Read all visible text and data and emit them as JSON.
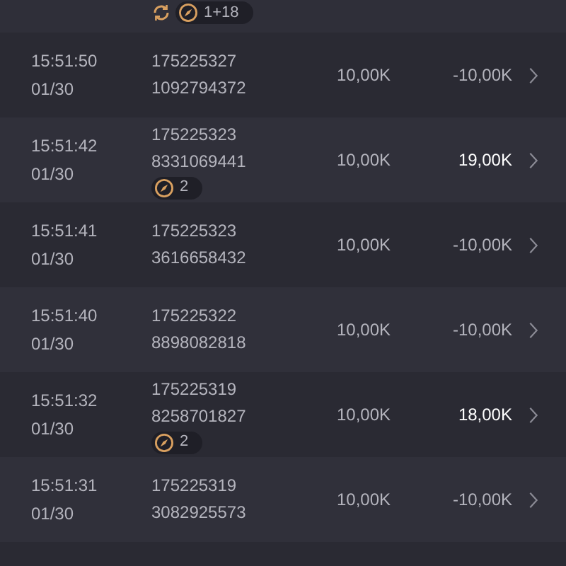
{
  "top_row": {
    "badges": [
      {
        "kind": "sync"
      },
      {
        "kind": "compass",
        "count": "1+18"
      }
    ]
  },
  "rows": [
    {
      "time": "15:51:50",
      "date": "01/30",
      "round": "175225327",
      "ticket": "1092794372",
      "badges": [],
      "bet": "10,00K",
      "result": "-10,00K",
      "won": false
    },
    {
      "time": "15:51:42",
      "date": "01/30",
      "round": "175225323",
      "ticket": "8331069441",
      "badges": [
        {
          "kind": "compass",
          "count": "2"
        }
      ],
      "bet": "10,00K",
      "result": "19,00K",
      "won": true
    },
    {
      "time": "15:51:41",
      "date": "01/30",
      "round": "175225323",
      "ticket": "3616658432",
      "badges": [],
      "bet": "10,00K",
      "result": "-10,00K",
      "won": false
    },
    {
      "time": "15:51:40",
      "date": "01/30",
      "round": "175225322",
      "ticket": "8898082818",
      "badges": [],
      "bet": "10,00K",
      "result": "-10,00K",
      "won": false
    },
    {
      "time": "15:51:32",
      "date": "01/30",
      "round": "175225319",
      "ticket": "8258701827",
      "badges": [
        {
          "kind": "compass",
          "count": "2"
        }
      ],
      "bet": "10,00K",
      "result": "18,00K",
      "won": true
    },
    {
      "time": "15:51:31",
      "date": "01/30",
      "round": "175225319",
      "ticket": "3082925573",
      "badges": [],
      "bet": "10,00K",
      "result": "-10,00K",
      "won": false
    }
  ]
}
